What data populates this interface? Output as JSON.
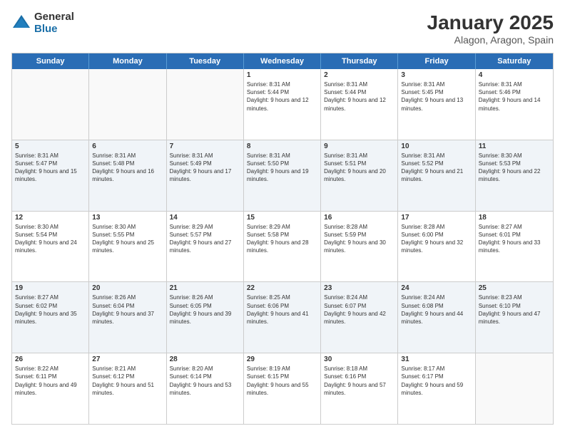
{
  "logo": {
    "general": "General",
    "blue": "Blue"
  },
  "title": "January 2025",
  "subtitle": "Alagon, Aragon, Spain",
  "days": [
    "Sunday",
    "Monday",
    "Tuesday",
    "Wednesday",
    "Thursday",
    "Friday",
    "Saturday"
  ],
  "weeks": [
    [
      {
        "day": "",
        "content": ""
      },
      {
        "day": "",
        "content": ""
      },
      {
        "day": "",
        "content": ""
      },
      {
        "day": "1",
        "content": "Sunrise: 8:31 AM\nSunset: 5:44 PM\nDaylight: 9 hours and 12 minutes."
      },
      {
        "day": "2",
        "content": "Sunrise: 8:31 AM\nSunset: 5:44 PM\nDaylight: 9 hours and 12 minutes."
      },
      {
        "day": "3",
        "content": "Sunrise: 8:31 AM\nSunset: 5:45 PM\nDaylight: 9 hours and 13 minutes."
      },
      {
        "day": "4",
        "content": "Sunrise: 8:31 AM\nSunset: 5:46 PM\nDaylight: 9 hours and 14 minutes."
      }
    ],
    [
      {
        "day": "5",
        "content": "Sunrise: 8:31 AM\nSunset: 5:47 PM\nDaylight: 9 hours and 15 minutes."
      },
      {
        "day": "6",
        "content": "Sunrise: 8:31 AM\nSunset: 5:48 PM\nDaylight: 9 hours and 16 minutes."
      },
      {
        "day": "7",
        "content": "Sunrise: 8:31 AM\nSunset: 5:49 PM\nDaylight: 9 hours and 17 minutes."
      },
      {
        "day": "8",
        "content": "Sunrise: 8:31 AM\nSunset: 5:50 PM\nDaylight: 9 hours and 19 minutes."
      },
      {
        "day": "9",
        "content": "Sunrise: 8:31 AM\nSunset: 5:51 PM\nDaylight: 9 hours and 20 minutes."
      },
      {
        "day": "10",
        "content": "Sunrise: 8:31 AM\nSunset: 5:52 PM\nDaylight: 9 hours and 21 minutes."
      },
      {
        "day": "11",
        "content": "Sunrise: 8:30 AM\nSunset: 5:53 PM\nDaylight: 9 hours and 22 minutes."
      }
    ],
    [
      {
        "day": "12",
        "content": "Sunrise: 8:30 AM\nSunset: 5:54 PM\nDaylight: 9 hours and 24 minutes."
      },
      {
        "day": "13",
        "content": "Sunrise: 8:30 AM\nSunset: 5:55 PM\nDaylight: 9 hours and 25 minutes."
      },
      {
        "day": "14",
        "content": "Sunrise: 8:29 AM\nSunset: 5:57 PM\nDaylight: 9 hours and 27 minutes."
      },
      {
        "day": "15",
        "content": "Sunrise: 8:29 AM\nSunset: 5:58 PM\nDaylight: 9 hours and 28 minutes."
      },
      {
        "day": "16",
        "content": "Sunrise: 8:28 AM\nSunset: 5:59 PM\nDaylight: 9 hours and 30 minutes."
      },
      {
        "day": "17",
        "content": "Sunrise: 8:28 AM\nSunset: 6:00 PM\nDaylight: 9 hours and 32 minutes."
      },
      {
        "day": "18",
        "content": "Sunrise: 8:27 AM\nSunset: 6:01 PM\nDaylight: 9 hours and 33 minutes."
      }
    ],
    [
      {
        "day": "19",
        "content": "Sunrise: 8:27 AM\nSunset: 6:02 PM\nDaylight: 9 hours and 35 minutes."
      },
      {
        "day": "20",
        "content": "Sunrise: 8:26 AM\nSunset: 6:04 PM\nDaylight: 9 hours and 37 minutes."
      },
      {
        "day": "21",
        "content": "Sunrise: 8:26 AM\nSunset: 6:05 PM\nDaylight: 9 hours and 39 minutes."
      },
      {
        "day": "22",
        "content": "Sunrise: 8:25 AM\nSunset: 6:06 PM\nDaylight: 9 hours and 41 minutes."
      },
      {
        "day": "23",
        "content": "Sunrise: 8:24 AM\nSunset: 6:07 PM\nDaylight: 9 hours and 42 minutes."
      },
      {
        "day": "24",
        "content": "Sunrise: 8:24 AM\nSunset: 6:08 PM\nDaylight: 9 hours and 44 minutes."
      },
      {
        "day": "25",
        "content": "Sunrise: 8:23 AM\nSunset: 6:10 PM\nDaylight: 9 hours and 47 minutes."
      }
    ],
    [
      {
        "day": "26",
        "content": "Sunrise: 8:22 AM\nSunset: 6:11 PM\nDaylight: 9 hours and 49 minutes."
      },
      {
        "day": "27",
        "content": "Sunrise: 8:21 AM\nSunset: 6:12 PM\nDaylight: 9 hours and 51 minutes."
      },
      {
        "day": "28",
        "content": "Sunrise: 8:20 AM\nSunset: 6:14 PM\nDaylight: 9 hours and 53 minutes."
      },
      {
        "day": "29",
        "content": "Sunrise: 8:19 AM\nSunset: 6:15 PM\nDaylight: 9 hours and 55 minutes."
      },
      {
        "day": "30",
        "content": "Sunrise: 8:18 AM\nSunset: 6:16 PM\nDaylight: 9 hours and 57 minutes."
      },
      {
        "day": "31",
        "content": "Sunrise: 8:17 AM\nSunset: 6:17 PM\nDaylight: 9 hours and 59 minutes."
      },
      {
        "day": "",
        "content": ""
      }
    ]
  ]
}
